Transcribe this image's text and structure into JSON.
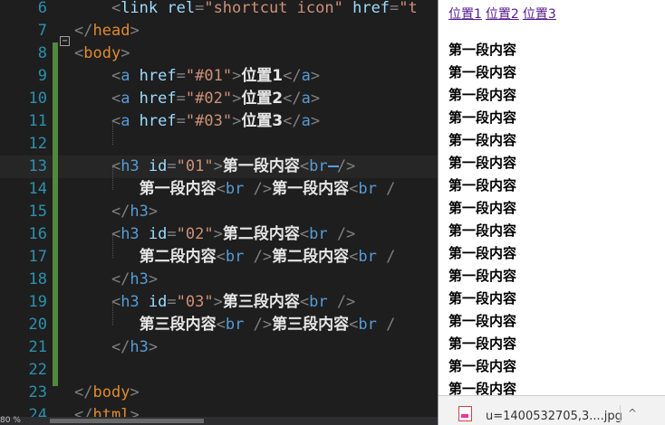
{
  "editor": {
    "lines": [
      {
        "n": "6",
        "tokens": [
          [
            "punc",
            "    <"
          ],
          [
            "attr",
            "link rel"
          ],
          [
            "punc",
            "="
          ],
          [
            "val",
            "\"shortcut icon\""
          ],
          [
            "attr",
            " href"
          ],
          [
            "punc",
            "="
          ],
          [
            "val",
            "\"t"
          ]
        ]
      },
      {
        "n": "7",
        "tokens": [
          [
            "punc",
            "</"
          ],
          [
            "tag2",
            "head"
          ],
          [
            "punc",
            ">"
          ]
        ]
      },
      {
        "n": "8",
        "tokens": [
          [
            "punc",
            "<"
          ],
          [
            "tag2",
            "body"
          ],
          [
            "punc",
            ">"
          ]
        ]
      },
      {
        "n": "9",
        "tokens": [
          [
            "punc",
            "    <"
          ],
          [
            "tag",
            "a"
          ],
          [
            "attr",
            " href"
          ],
          [
            "punc",
            "="
          ],
          [
            "val",
            "\"#01\""
          ],
          [
            "punc",
            ">"
          ],
          [
            "txt",
            "位置1"
          ],
          [
            "punc",
            "</"
          ],
          [
            "tag",
            "a"
          ],
          [
            "punc",
            ">"
          ]
        ]
      },
      {
        "n": "10",
        "tokens": [
          [
            "punc",
            "    <"
          ],
          [
            "tag",
            "a"
          ],
          [
            "attr",
            " href"
          ],
          [
            "punc",
            "="
          ],
          [
            "val",
            "\"#02\""
          ],
          [
            "punc",
            ">"
          ],
          [
            "txt",
            "位置2"
          ],
          [
            "punc",
            "</"
          ],
          [
            "tag",
            "a"
          ],
          [
            "punc",
            ">"
          ]
        ]
      },
      {
        "n": "11",
        "tokens": [
          [
            "punc",
            "    <"
          ],
          [
            "tag",
            "a"
          ],
          [
            "attr",
            " href"
          ],
          [
            "punc",
            "="
          ],
          [
            "val",
            "\"#03\""
          ],
          [
            "punc",
            ">"
          ],
          [
            "txt",
            "位置3"
          ],
          [
            "punc",
            "</"
          ],
          [
            "tag",
            "a"
          ],
          [
            "punc",
            ">"
          ]
        ]
      },
      {
        "n": "12",
        "tokens": []
      },
      {
        "n": "13",
        "tokens": [
          [
            "punc",
            "    <"
          ],
          [
            "tag",
            "h3"
          ],
          [
            "attr",
            " id"
          ],
          [
            "punc",
            "="
          ],
          [
            "val",
            "\"01\""
          ],
          [
            "punc",
            ">"
          ],
          [
            "txt",
            "第一段内容"
          ],
          [
            "punc",
            "<"
          ],
          [
            "tag",
            "br"
          ],
          [
            "punc",
            " />"
          ]
        ]
      },
      {
        "n": "14",
        "tokens": [
          [
            "punc",
            "       "
          ],
          [
            "txt",
            "第一段内容"
          ],
          [
            "punc",
            "<"
          ],
          [
            "tag",
            "br"
          ],
          [
            "punc",
            " />"
          ],
          [
            "txt",
            "第一段内容"
          ],
          [
            "punc",
            "<"
          ],
          [
            "tag",
            "br"
          ],
          [
            "punc",
            " /"
          ]
        ]
      },
      {
        "n": "15",
        "tokens": [
          [
            "punc",
            "    </"
          ],
          [
            "tag",
            "h3"
          ],
          [
            "punc",
            ">"
          ]
        ]
      },
      {
        "n": "16",
        "tokens": [
          [
            "punc",
            "    <"
          ],
          [
            "tag",
            "h3"
          ],
          [
            "attr",
            " id"
          ],
          [
            "punc",
            "="
          ],
          [
            "val",
            "\"02\""
          ],
          [
            "punc",
            ">"
          ],
          [
            "txt",
            "第二段内容"
          ],
          [
            "punc",
            "<"
          ],
          [
            "tag",
            "br"
          ],
          [
            "punc",
            " />"
          ]
        ]
      },
      {
        "n": "17",
        "tokens": [
          [
            "punc",
            "       "
          ],
          [
            "txt",
            "第二段内容"
          ],
          [
            "punc",
            "<"
          ],
          [
            "tag",
            "br"
          ],
          [
            "punc",
            " />"
          ],
          [
            "txt",
            "第二段内容"
          ],
          [
            "punc",
            "<"
          ],
          [
            "tag",
            "br"
          ],
          [
            "punc",
            " /"
          ]
        ]
      },
      {
        "n": "18",
        "tokens": [
          [
            "punc",
            "    </"
          ],
          [
            "tag",
            "h3"
          ],
          [
            "punc",
            ">"
          ]
        ]
      },
      {
        "n": "19",
        "tokens": [
          [
            "punc",
            "    <"
          ],
          [
            "tag",
            "h3"
          ],
          [
            "attr",
            " id"
          ],
          [
            "punc",
            "="
          ],
          [
            "val",
            "\"03\""
          ],
          [
            "punc",
            ">"
          ],
          [
            "txt",
            "第三段内容"
          ],
          [
            "punc",
            "<"
          ],
          [
            "tag",
            "br"
          ],
          [
            "punc",
            " />"
          ]
        ]
      },
      {
        "n": "20",
        "tokens": [
          [
            "punc",
            "       "
          ],
          [
            "txt",
            "第三段内容"
          ],
          [
            "punc",
            "<"
          ],
          [
            "tag",
            "br"
          ],
          [
            "punc",
            " />"
          ],
          [
            "txt",
            "第三段内容"
          ],
          [
            "punc",
            "<"
          ],
          [
            "tag",
            "br"
          ],
          [
            "punc",
            " /"
          ]
        ]
      },
      {
        "n": "21",
        "tokens": [
          [
            "punc",
            "    </"
          ],
          [
            "tag",
            "h3"
          ],
          [
            "punc",
            ">"
          ]
        ]
      },
      {
        "n": "22",
        "tokens": []
      },
      {
        "n": "23",
        "tokens": [
          [
            "punc",
            "</"
          ],
          [
            "tag2",
            "body"
          ],
          [
            "punc",
            ">"
          ]
        ]
      },
      {
        "n": "24",
        "tokens": [
          [
            "punc",
            "</"
          ],
          [
            "tag2",
            "html"
          ],
          [
            "punc",
            ">"
          ]
        ]
      }
    ],
    "scroll_zoom": "80 %",
    "fold_symbol": "−"
  },
  "browser": {
    "links": [
      "位置1",
      "位置2",
      "位置3"
    ],
    "paragraph_lines": [
      "第一段内容",
      "第一段内容",
      "第一段内容",
      "第一段内容",
      "第一段内容",
      "第一段内容",
      "第一段内容",
      "第一段内容",
      "第一段内容",
      "第一段内容",
      "第一段内容",
      "第一段内容",
      "第一段内容",
      "第一段内容",
      "第一段内容",
      "第一段内容"
    ],
    "download": {
      "filename": "u=1400532705,3....jpg",
      "chevron": "^"
    }
  }
}
